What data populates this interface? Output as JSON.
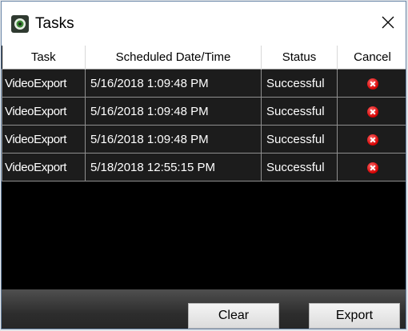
{
  "window": {
    "title": "Tasks",
    "close_glyph": "✕"
  },
  "table": {
    "columns": [
      "Task",
      "Scheduled Date/Time",
      "Status",
      "Cancel"
    ],
    "rows": [
      {
        "task": "VideoExport",
        "datetime": "5/16/2018 1:09:48 PM",
        "status": "Successful"
      },
      {
        "task": "VideoExport",
        "datetime": "5/16/2018 1:09:48 PM",
        "status": "Successful"
      },
      {
        "task": "VideoExport",
        "datetime": "5/16/2018 1:09:48 PM",
        "status": "Successful"
      },
      {
        "task": "VideoExport",
        "datetime": "5/18/2018 12:55:15 PM",
        "status": "Successful"
      }
    ]
  },
  "footer": {
    "clear_label": "Clear",
    "export_label": "Export"
  },
  "colors": {
    "cancel_icon": "#d40000",
    "row_background": "#1c1c1c",
    "table_background": "#000000"
  }
}
